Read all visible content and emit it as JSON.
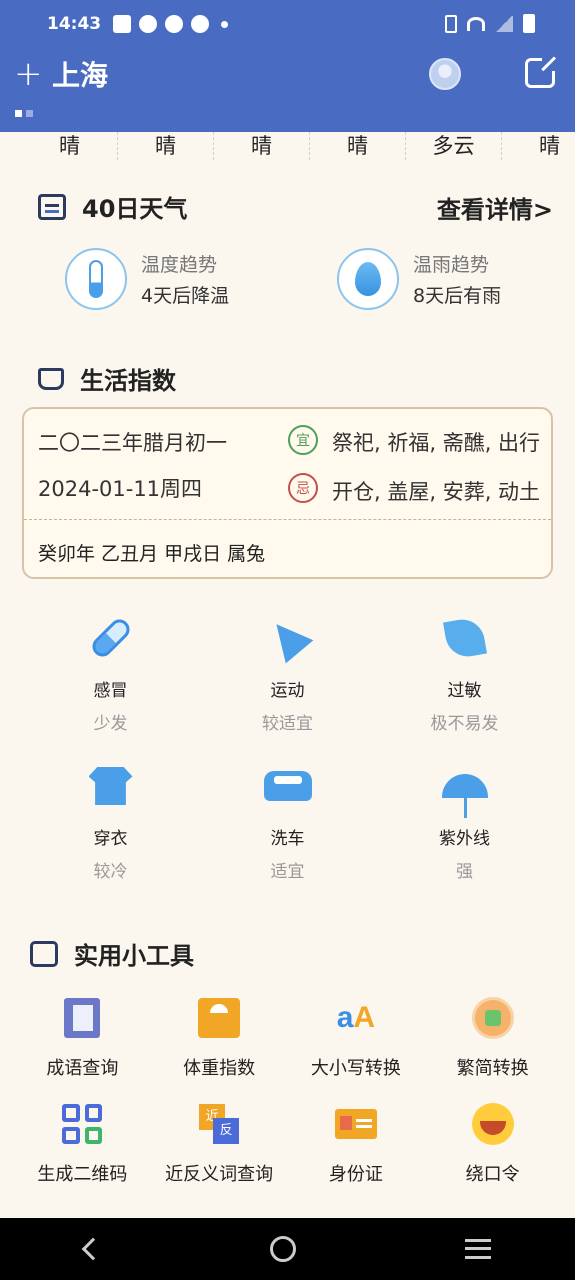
{
  "status_bar": {
    "time": "14:43"
  },
  "header": {
    "add_label": "+",
    "city": "上海"
  },
  "weather_strip": [
    "晴",
    "晴",
    "晴",
    "晴",
    "多云",
    "晴"
  ],
  "forty_day": {
    "title": "40日天气",
    "more": "查看详情>",
    "temp_trend": {
      "label": "温度趋势",
      "value": "4天后降温"
    },
    "rain_trend": {
      "label": "温雨趋势",
      "value": "8天后有雨"
    }
  },
  "life_index": {
    "title": "生活指数",
    "almanac": {
      "lunar_date": "二〇二三年腊月初一",
      "solar_date": "2024-01-11周四",
      "yi_stamp": "宜",
      "yi": "祭祀, 祈福, 斋醮, 出行",
      "ji_stamp": "忌",
      "ji": "开仓, 盖屋, 安葬, 动土",
      "ganzhi": "癸卯年 乙丑月 甲戌日 属兔"
    },
    "items": [
      {
        "name": "感冒",
        "value": "少发"
      },
      {
        "name": "运动",
        "value": "较适宜"
      },
      {
        "name": "过敏",
        "value": "极不易发"
      },
      {
        "name": "穿衣",
        "value": "较冷"
      },
      {
        "name": "洗车",
        "value": "适宜"
      },
      {
        "name": "紫外线",
        "value": "强"
      }
    ]
  },
  "tools": {
    "title": "实用小工具",
    "items": [
      {
        "name": "成语查询"
      },
      {
        "name": "体重指数"
      },
      {
        "name": "大小写转换"
      },
      {
        "name": "繁简转换"
      },
      {
        "name": "生成二维码"
      },
      {
        "name": "近反义词查询"
      },
      {
        "name": "身份证"
      },
      {
        "name": "绕口令"
      }
    ]
  },
  "colors": {
    "header": "#4A6BC2",
    "background": "#FBF6EE",
    "accent": "#4A9FE8"
  }
}
